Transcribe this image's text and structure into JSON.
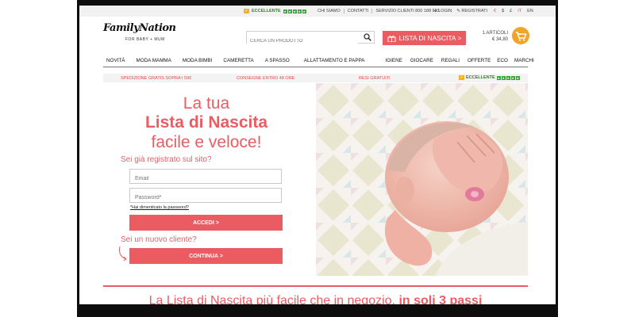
{
  "topbar": {
    "trust_label": "ECCELLENTE",
    "links": [
      "CHI SIAMO",
      "CONTATTI",
      "SERVIZIO CLIENTI 800 188 923"
    ],
    "login": "LOGIN",
    "register": "REGISTRATI",
    "currencies": [
      "€",
      "$",
      "£"
    ],
    "languages": [
      "IT",
      "EN"
    ]
  },
  "logo": {
    "brand": "FamilyNation",
    "tagline": "FOR BABY + MUM"
  },
  "search": {
    "placeholder": "CERCA UN PRODOTTO"
  },
  "lista_button": {
    "label": "LISTA DI NASCITA >"
  },
  "cart": {
    "items": "1 ARTICOLI",
    "total": "€ 34,80"
  },
  "nav": [
    "NOVITÀ",
    "MODA MAMMA",
    "MODA BIMBI",
    "CAMERETTA",
    "A SPASSO",
    "ALLATTAMENTO E PAPPA",
    "IGIENE",
    "GIOCARE",
    "REGALI",
    "OFFERTE",
    "ECO",
    "MARCHI"
  ],
  "promo": {
    "shipping": "SPEDIZIONE GRATIS SOPRA I 59€",
    "delivery": "CONSEGNE ENTRO 48 ORE",
    "returns": "RESI GRATUITI",
    "trust": "ECCELLENTE"
  },
  "hero": {
    "line1": "La tua",
    "line2": "Lista di Nascita",
    "line3": "facile e veloce!"
  },
  "login_form": {
    "question": "Sei già registrato sul sito?",
    "email_placeholder": "Email",
    "password_placeholder": "Password*",
    "forgot": "*Hai dimenticato la password?",
    "submit": "ACCEDI >"
  },
  "new_customer": {
    "question": "Sei un nuovo cliente?",
    "button": "CONTINUA >"
  },
  "banner": {
    "text": "La Lista di Nascita più facile che in negozio,",
    "bold": "in soli 3 passi"
  },
  "colors": {
    "accent": "#ea5c62",
    "cart": "#f0a428",
    "trust_green": "#3aa23a"
  }
}
